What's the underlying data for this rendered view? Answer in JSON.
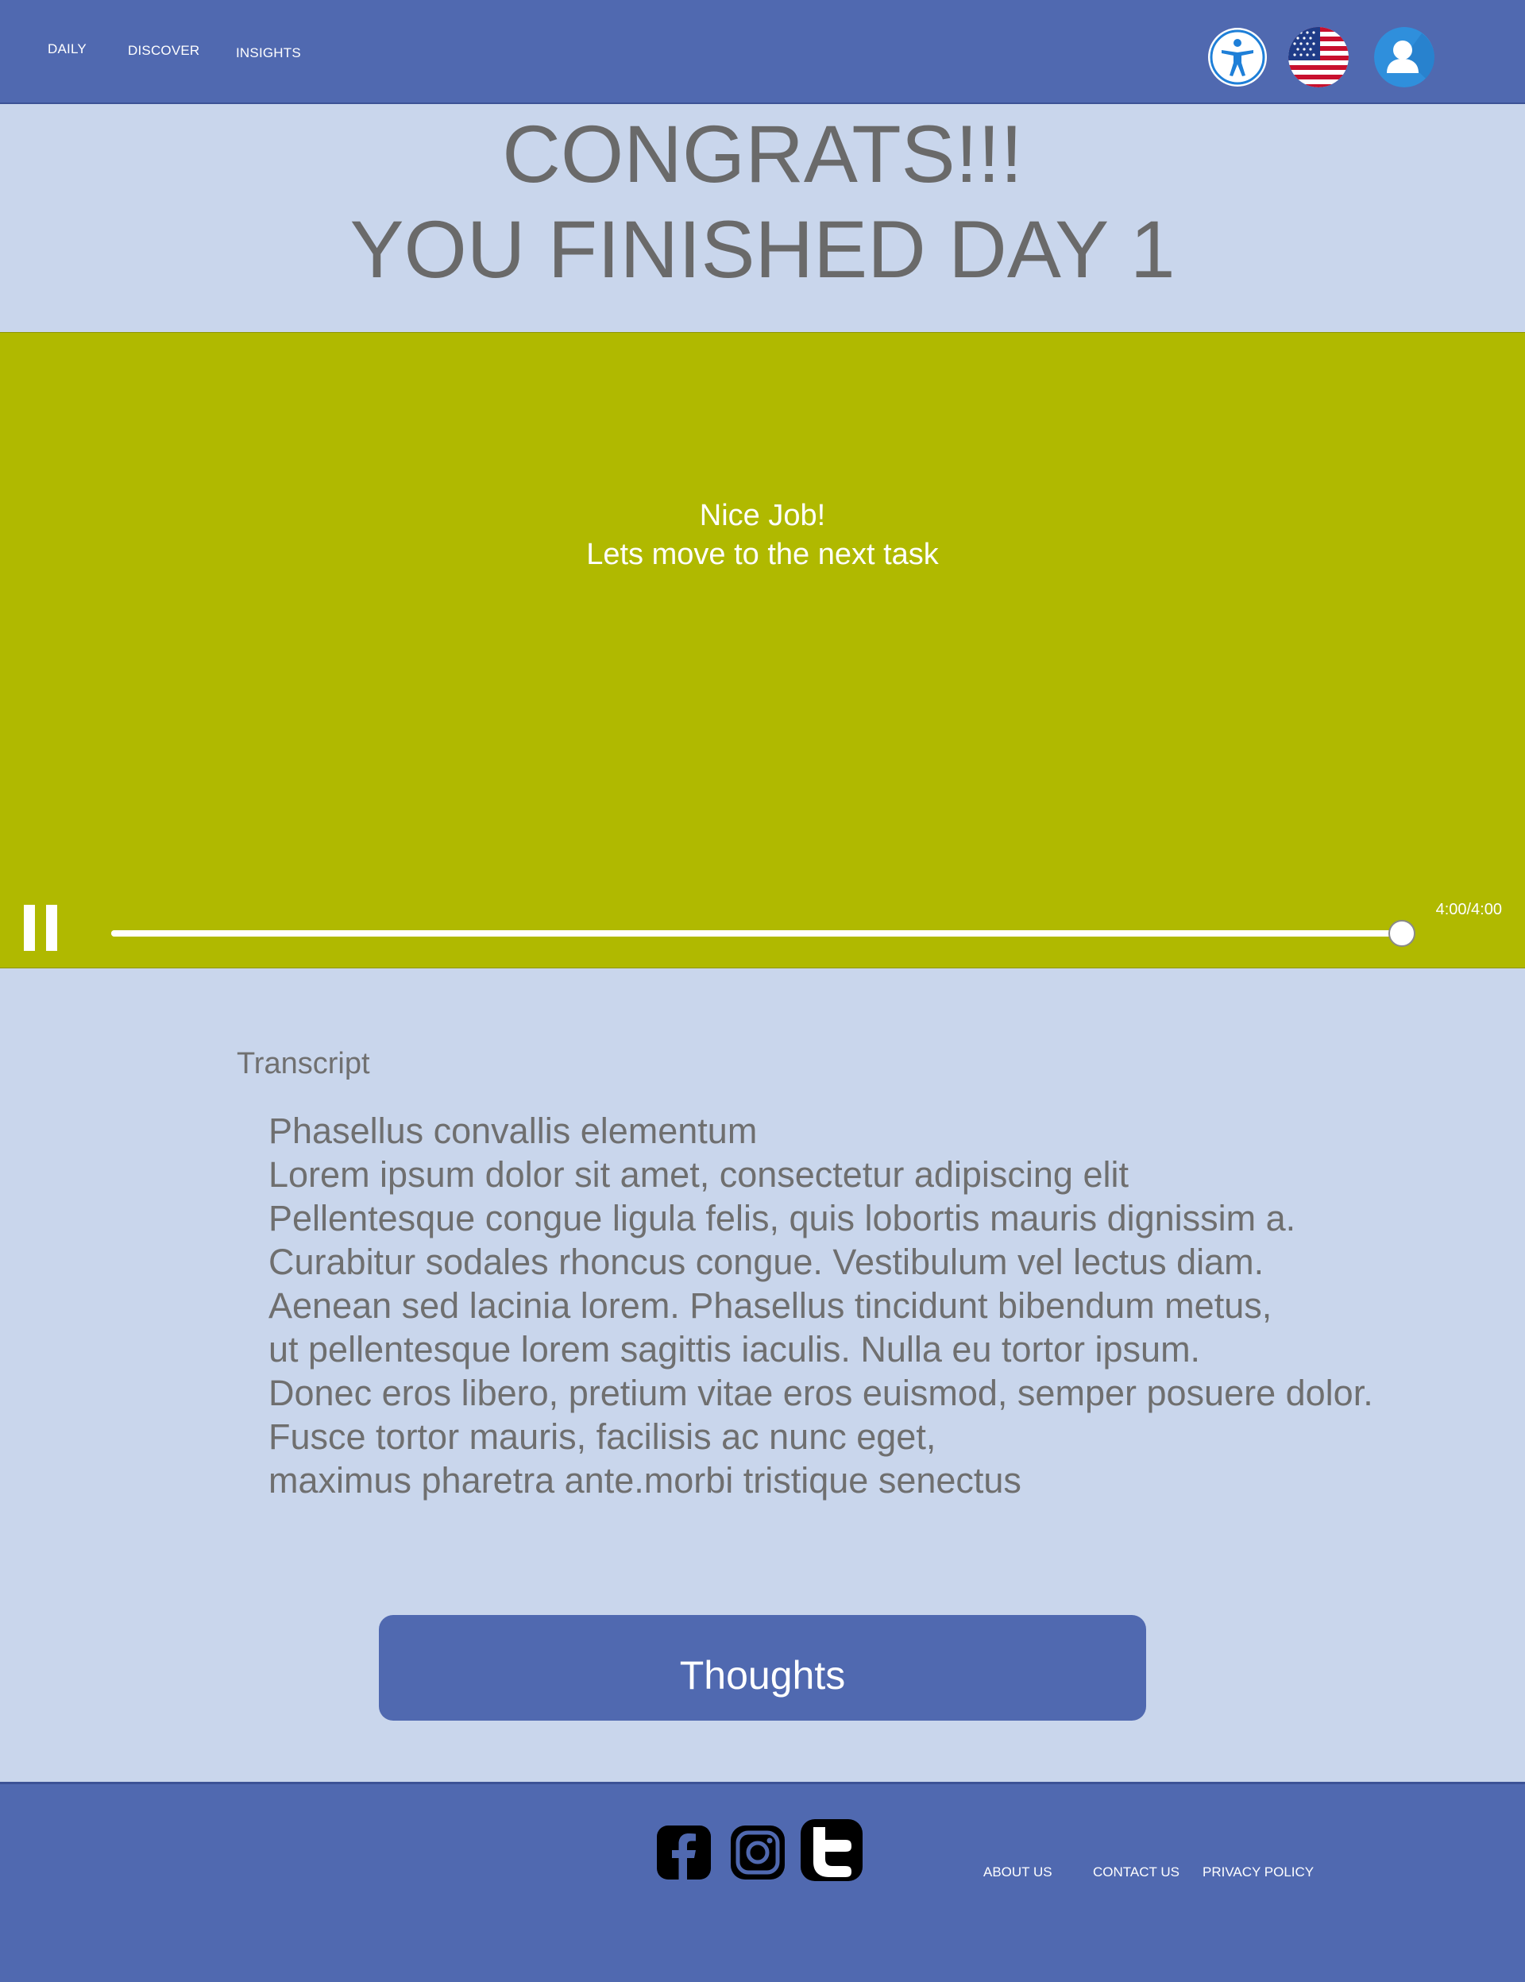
{
  "nav": {
    "daily": "DAILY",
    "discover": "DISCOVER",
    "insights": "INSIGHTS"
  },
  "header_icons": [
    "accessibility-icon",
    "us-flag-icon",
    "user-profile-icon"
  ],
  "headline": {
    "line1": "CONGRATS!!!",
    "line2": "YOU FINISHED DAY 1"
  },
  "video": {
    "caption_line1": "Nice Job!",
    "caption_line2": "Lets move to the next task",
    "time": "4:00/4:00",
    "progress": 1.0,
    "state_icon": "pause-icon",
    "background": "#b0b900"
  },
  "transcript": {
    "label": "Transcript",
    "lines": [
      "Phasellus convallis elementum",
      "Lorem ipsum dolor sit amet, consectetur adipiscing elit",
      "Pellentesque congue ligula felis, quis lobortis mauris dignissim a.",
      "Curabitur sodales rhoncus congue. Vestibulum vel lectus diam.",
      "Aenean sed lacinia lorem. Phasellus tincidunt bibendum metus,",
      "ut pellentesque lorem sagittis iaculis. Nulla eu tortor ipsum.",
      "Donec eros libero, pretium vitae eros euismod, semper posuere dolor.",
      "Fusce tortor mauris, facilisis ac nunc eget,",
      "maximus pharetra ante.morbi tristique senectus"
    ]
  },
  "thoughts_button": "Thoughts",
  "footer": {
    "social_icons": [
      "facebook-icon",
      "instagram-icon",
      "twitter-icon"
    ],
    "about": "ABOUT US",
    "contact": "CONTACT US",
    "privacy": "PRIVACY POLICY"
  },
  "colors": {
    "brand_blue": "#5069b0",
    "page_background": "#c9d6ec",
    "video_background": "#b0b900",
    "text_gray": "#6a6a6a"
  }
}
